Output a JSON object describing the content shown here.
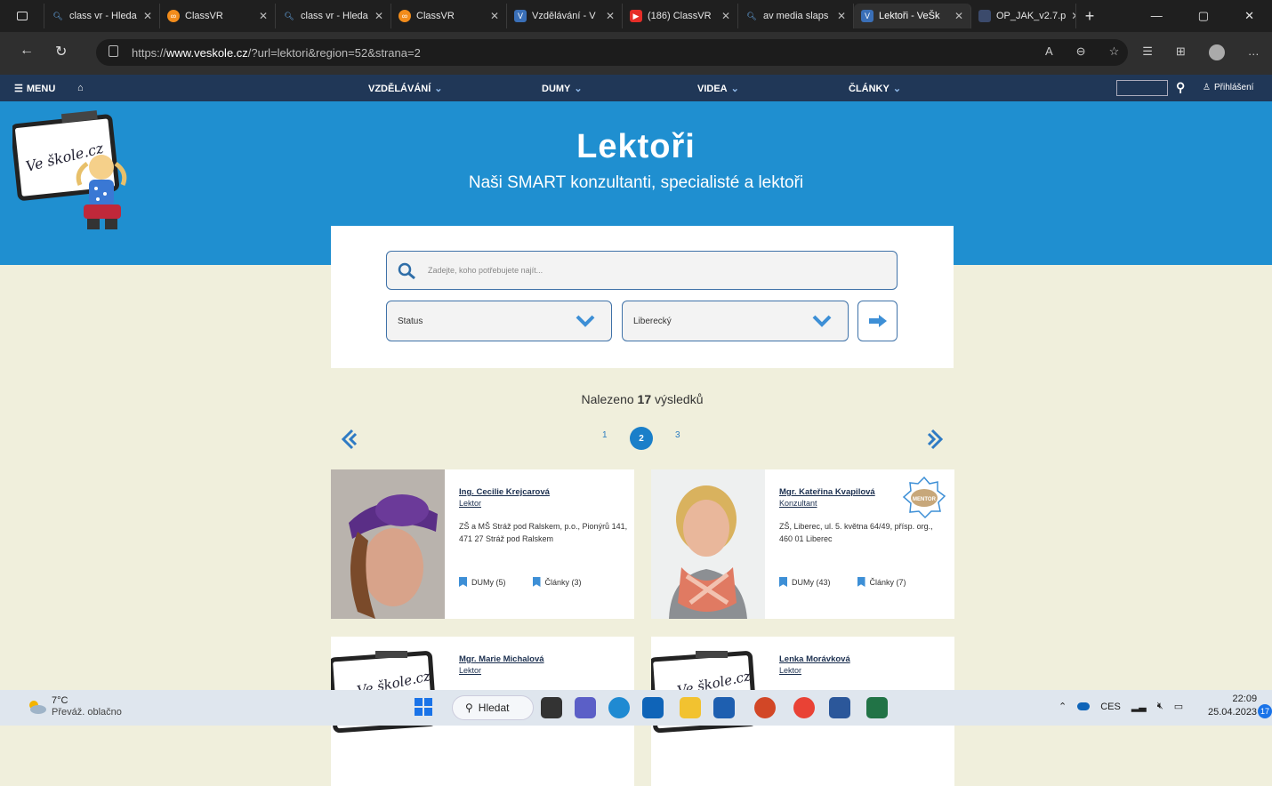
{
  "browser": {
    "tabs": [
      {
        "label": "class vr - Hleda",
        "icon": "search-icon",
        "color": "#3b82c4"
      },
      {
        "label": "ClassVR",
        "icon": "classvr-icon",
        "color": "#f28c1b"
      },
      {
        "label": "class vr - Hleda",
        "icon": "search-icon",
        "color": "#3b82c4"
      },
      {
        "label": "ClassVR",
        "icon": "classvr-icon",
        "color": "#f28c1b"
      },
      {
        "label": "Vzdělávání - V",
        "icon": "veskole-icon",
        "color": "#3a6fb7"
      },
      {
        "label": "(186) ClassVR",
        "icon": "youtube-icon",
        "color": "#e52d27"
      },
      {
        "label": "av media slaps",
        "icon": "search-icon",
        "color": "#3b82c4"
      },
      {
        "label": "Lektoři - VeŠk",
        "icon": "veskole-icon",
        "color": "#3a6fb7"
      },
      {
        "label": "OP_JAK_v2.7.p",
        "icon": "pdf-icon",
        "color": "#3b4a6b"
      }
    ],
    "url_prefix": "https://",
    "url_domain": "www.veskole.cz",
    "url_rest": "/?url=lektori&region=52&strana=2"
  },
  "sitenav": {
    "menu": "MENU",
    "items": [
      "VZDĚLÁVÁNÍ",
      "DUMY",
      "VIDEA",
      "ČLÁNKY"
    ],
    "login": "Přihlášení"
  },
  "hero": {
    "title": "Lektoři",
    "subtitle": "Naši SMART konzultanti, specialisté a lektoři",
    "color": "#1f8fd0"
  },
  "search": {
    "placeholder": "Zadejte, koho potřebujete najít...",
    "status": "Status",
    "region": "Liberecký"
  },
  "results": {
    "prefix": "Nalezeno",
    "count": "17",
    "suffix": "výsledků"
  },
  "pager": {
    "pages": [
      "1",
      "2",
      "3"
    ],
    "current": "2"
  },
  "cards": [
    {
      "name": "Ing. Cecilie Krejcarová",
      "role": "Lektor",
      "address": "ZŠ a MŠ Stráž pod Ralskem, p.o., Pionýrů 141, 471 27 Stráž pod Ralskem",
      "dumy": "DUMy (5)",
      "clanky": "Články (3)"
    },
    {
      "name": "Mgr. Kateřina Kvapilová",
      "role": "Konzultant",
      "badge": "MENTOR",
      "address": "ZŠ, Liberec, ul. 5. května 64/49, přísp. org., 460 01 Liberec",
      "dumy": "DUMy (43)",
      "clanky": "Články (7)"
    },
    {
      "name": "Mgr. Marie Michalová",
      "role": "Lektor"
    },
    {
      "name": "Lenka Morávková",
      "role": "Lektor"
    }
  ],
  "taskbar": {
    "temp": "7°C",
    "weather": "Převáž. oblačno",
    "search": "Hledat",
    "lang": "CES",
    "time": "22:09",
    "date": "25.04.2023",
    "notifications": "17"
  }
}
